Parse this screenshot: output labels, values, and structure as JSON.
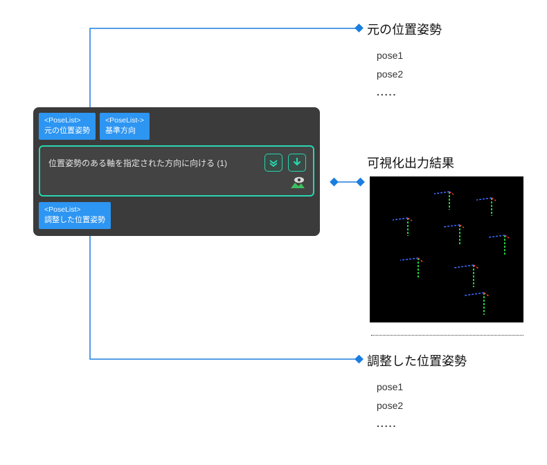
{
  "node": {
    "inputs": [
      {
        "type": "<PoseList>",
        "name": "元の位置姿勢"
      },
      {
        "type": "<PoseList->",
        "name": "基準方向"
      }
    ],
    "title": "位置姿勢のある軸を指定された方向に向ける (1)",
    "outputs": [
      {
        "type": "<PoseList>",
        "name": "調整した位置姿勢"
      }
    ],
    "icons": {
      "expand": "expand-down-icon",
      "execute": "run-down-icon",
      "visualize": "eye-image-icon"
    }
  },
  "sections": {
    "original": {
      "title": "元の位置姿勢",
      "items": [
        "pose1",
        "pose2",
        "....."
      ]
    },
    "viz": {
      "title": "可視化出力結果"
    },
    "adjusted": {
      "title": "調整した位置姿勢",
      "items": [
        "pose1",
        "pose2",
        "....."
      ]
    }
  },
  "colors": {
    "accent": "#2d95f2",
    "nodeBorder": "#29d6b1",
    "nodeBg": "#3b3b3b"
  }
}
